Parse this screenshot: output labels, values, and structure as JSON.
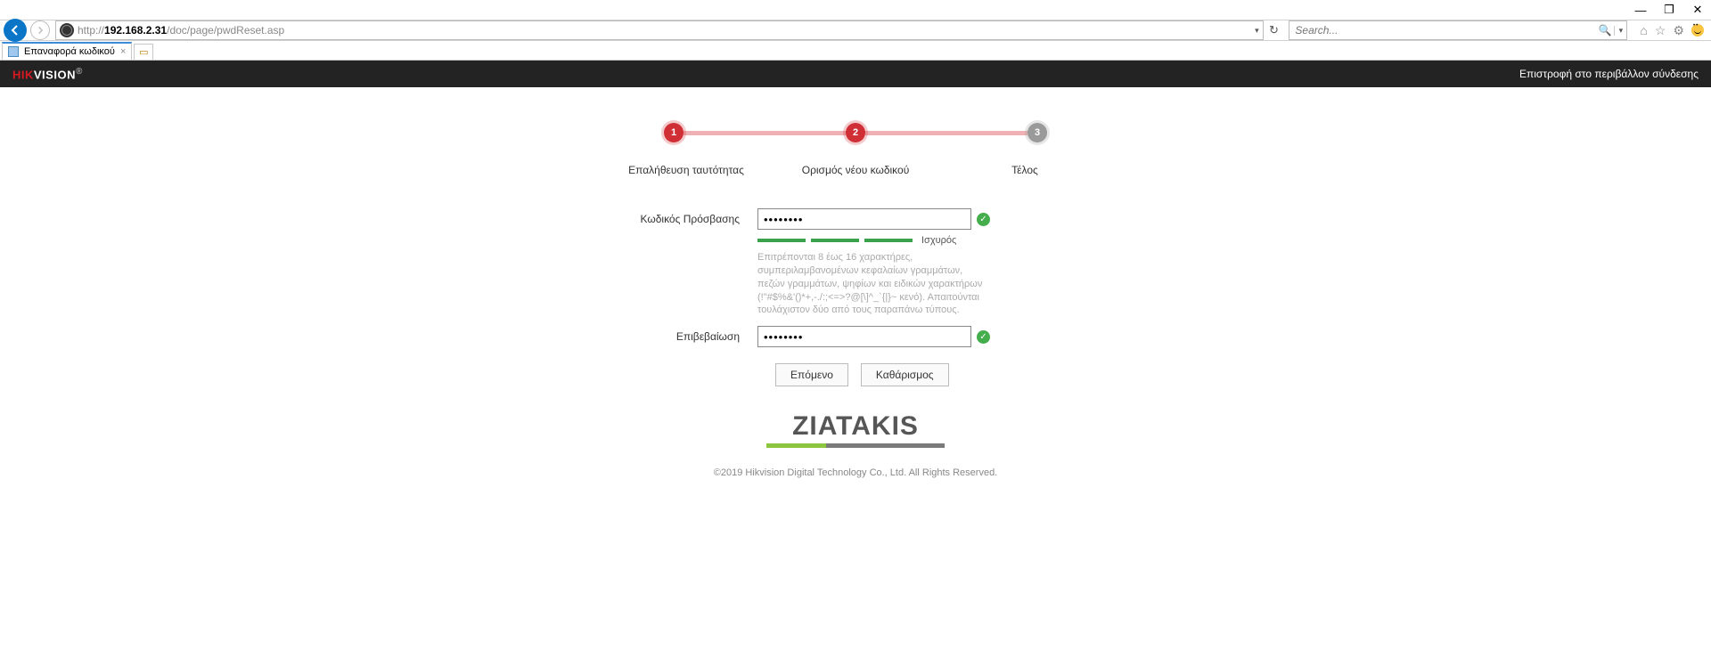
{
  "browser": {
    "url_host": "192.168.2.31",
    "url_path": "/doc/page/pwdReset.asp",
    "url_prefix": "http://",
    "search_placeholder": "Search...",
    "tab_title": "Επαναφορά κωδικού"
  },
  "header": {
    "logo_left": "HIK",
    "logo_right": "VISION",
    "logo_r": "®",
    "return_link": "Επιστροφή στο περιβάλλον σύνδεσης"
  },
  "stepper": {
    "s1": "1",
    "s2": "2",
    "s3": "3",
    "l1": "Επαλήθευση ταυτότητας",
    "l2": "Ορισμός νέου κωδικού",
    "l3": "Τέλος"
  },
  "form": {
    "password_label": "Κωδικός Πρόσβασης",
    "password_value": "••••••••",
    "confirm_label": "Επιβεβαίωση",
    "confirm_value": "••••••••",
    "strength_label": "Ισχυρός",
    "hint": "Επιτρέπονται 8 έως 16 χαρακτήρες, συμπεριλαμβανομένων κεφαλαίων γραμμάτων, πεζών γραμμάτων, ψηφίων και ειδικών χαρακτήρων (!\"#$%&'()*+,-./:;<=>?@[\\]^_`{|}~ κενό). Απαιτούνται τουλάχιστον δύο από τους παραπάνω τύπους.",
    "next_btn": "Επόμενο",
    "clear_btn": "Καθάρισμος"
  },
  "footer": {
    "brand": "ZIATAKIS",
    "copyright": "©2019 Hikvision Digital Technology Co., Ltd. All Rights Reserved."
  }
}
